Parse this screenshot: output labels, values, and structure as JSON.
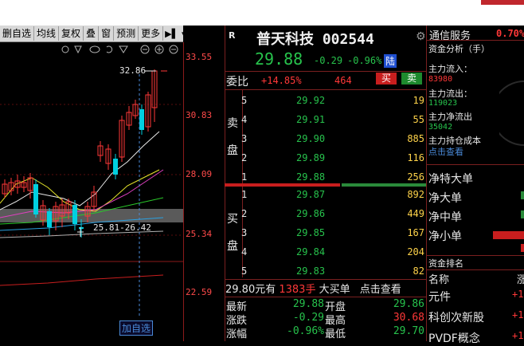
{
  "toolbar": {
    "items": [
      "删自选",
      "均线",
      "复权",
      "叠",
      "窗",
      "预测",
      "更多"
    ]
  },
  "chart": {
    "y_ticks": [
      "33.55",
      "30.83",
      "28.09",
      "25.34",
      "22.59"
    ],
    "high_label": "32.86",
    "support_label": "25.81-26.42",
    "add_button": "加自选"
  },
  "quote": {
    "badge": "R",
    "name_code": "普天科技 002544",
    "price": "29.88",
    "change": "-0.29",
    "change_pct": "-0.96%",
    "market_tag": "陆",
    "webi_label": "委比",
    "webi_value": "+14.85%",
    "webi_diff": "464",
    "buy_btn": "买",
    "sell_btn": "卖",
    "sell_label": [
      "卖",
      "盘"
    ],
    "buy_label": [
      "买",
      "盘"
    ],
    "asks": [
      {
        "level": "5",
        "price": "29.92",
        "vol": "19"
      },
      {
        "level": "4",
        "price": "29.91",
        "vol": "55"
      },
      {
        "level": "3",
        "price": "29.90",
        "vol": "885"
      },
      {
        "level": "2",
        "price": "29.89",
        "vol": "116"
      },
      {
        "level": "1",
        "price": "29.88",
        "vol": "256"
      }
    ],
    "bids": [
      {
        "level": "1",
        "price": "29.87",
        "vol": "892"
      },
      {
        "level": "2",
        "price": "29.86",
        "vol": "449"
      },
      {
        "level": "3",
        "price": "29.85",
        "vol": "167"
      },
      {
        "level": "4",
        "price": "29.84",
        "vol": "204"
      },
      {
        "level": "5",
        "price": "29.83",
        "vol": "82"
      }
    ],
    "big_order": {
      "price": "29.80元有",
      "qty": "1383手",
      "text": "大买单",
      "link": "点击查看"
    },
    "stats": [
      {
        "label": "最新",
        "value": "29.88",
        "label2": "开盘",
        "value2": "29.86"
      },
      {
        "label": "涨跌",
        "value": "-0.29",
        "label2": "最高",
        "value2": "30.68"
      },
      {
        "label": "涨幅",
        "value": "-0.96%",
        "label2": "最低",
        "value2": "29.70"
      }
    ]
  },
  "right": {
    "header": "通信服务",
    "header_pct": "0.70%",
    "flow_title": "资金分析（手）",
    "inflow_label": "主力流入：",
    "inflow_value": "83980",
    "outflow_label": "主力流出：",
    "outflow_value": "119023",
    "net_label": "主力净流出",
    "net_value": "35042",
    "cost_label": "主力持仓成本",
    "cost_link": "点击查看",
    "bars": [
      "净特大单",
      "净大单",
      "净中单",
      "净小单"
    ],
    "rank_title": "资金排名",
    "rank_col": "名称",
    "rank_col2": "涨",
    "rank_items": [
      {
        "name": "元件",
        "val": "+1"
      },
      {
        "name": "科创次新股",
        "val": "+1"
      },
      {
        "name": "PVDF概念",
        "val": "+1"
      }
    ]
  },
  "colors": {
    "up": "#ff3838",
    "down": "#27c24c",
    "bg": "#000000"
  }
}
